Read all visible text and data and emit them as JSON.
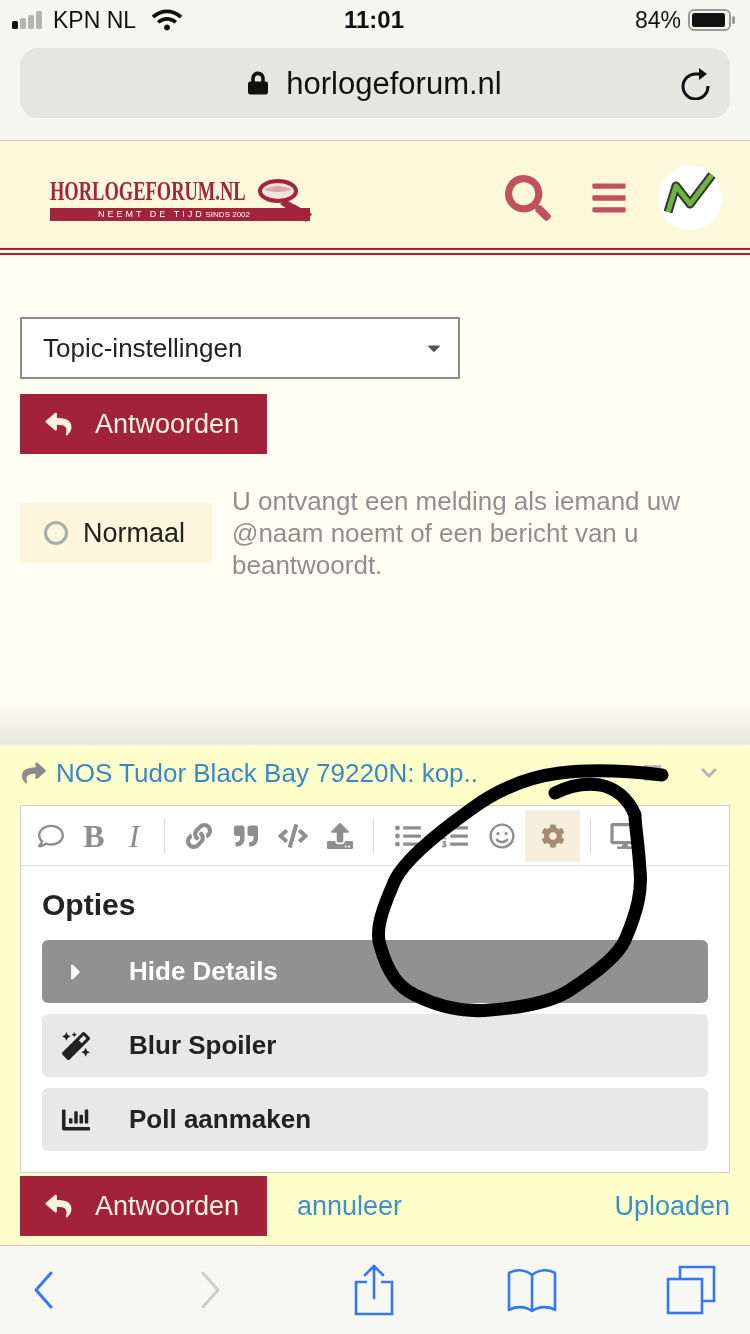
{
  "status_bar": {
    "carrier": "KPN NL",
    "time": "11:01",
    "battery": "84%"
  },
  "address_bar": {
    "url": "horlogeforum.nl"
  },
  "header": {
    "logo": {
      "title": "HORLOGEFORUM.NL",
      "tagline": "NEEMT DE TIJD",
      "since": "SINDS 2002"
    }
  },
  "topic_settings": {
    "select": {
      "value": "Topic-instellingen"
    },
    "reply_button": "Antwoorden",
    "notification": {
      "label": "Normaal",
      "selected": false,
      "description": "U ontvangt een melding als iemand uw @naam noemt of een bericht van u beantwoordt."
    }
  },
  "reply_panel": {
    "title": "NOS Tudor Black Bay 79220N: kop..",
    "toolbar_groups": [
      [
        {
          "kind": "comment",
          "selected": false
        },
        {
          "kind": "bold",
          "label": "B",
          "selected": false
        },
        {
          "kind": "italic",
          "label": "I",
          "selected": false
        }
      ],
      [
        {
          "kind": "link",
          "selected": false
        },
        {
          "kind": "quote",
          "selected": false
        },
        {
          "kind": "code",
          "selected": false
        },
        {
          "kind": "upload",
          "selected": false
        }
      ],
      [
        {
          "kind": "bullet_list",
          "selected": false
        },
        {
          "kind": "numbered_list",
          "selected": false
        },
        {
          "kind": "smiley",
          "selected": false
        },
        {
          "kind": "settings",
          "selected": true
        }
      ],
      [
        {
          "kind": "preview",
          "selected": false
        }
      ]
    ],
    "options": {
      "heading": "Opties",
      "items": [
        {
          "kind": "details",
          "label": "Hide Details",
          "selected": true
        },
        {
          "kind": "spoiler",
          "label": "Blur Spoiler",
          "selected": false
        },
        {
          "kind": "poll",
          "label": "Poll aanmaken",
          "selected": false
        }
      ]
    },
    "reply_button": "Antwoorden",
    "cancel_link": "annuleer",
    "upload_link": "Uploaden"
  },
  "browser_toolbar": {
    "back": {
      "disabled": false
    },
    "forward": {
      "disabled": true
    }
  }
}
